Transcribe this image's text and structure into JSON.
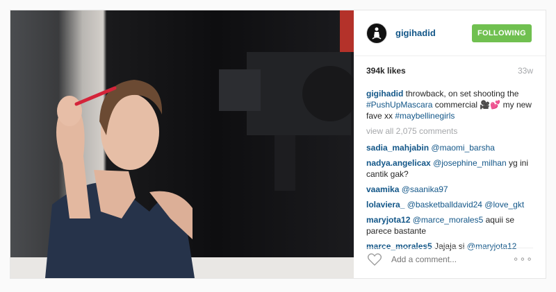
{
  "post": {
    "username": "gigihadid",
    "follow_label": "FOLLOWING",
    "likes": "394k likes",
    "age": "33w",
    "caption": {
      "user": "gigihadid",
      "text1": "throwback, on set shooting the",
      "tag1": "#PushUpMascara",
      "text2": "commercial 🎥💕 my new fave xx",
      "tag2": "#maybellinegirls"
    },
    "view_all": "view all 2,075 comments",
    "comments": [
      {
        "user": "sadia_mahjabin",
        "mention": "@maomi_barsha",
        "text": ""
      },
      {
        "user": "nadya.angelicax",
        "mention": "@josephine_milhan",
        "text": "yg ini cantik gak?"
      },
      {
        "user": "vaamika",
        "mention": "@saanika97",
        "text": ""
      },
      {
        "user": "lolaviera_",
        "mention": "@basketballdavid24 @love_gkt",
        "text": ""
      },
      {
        "user": "maryjota12",
        "mention": "@marce_morales5",
        "text": "aquii se parece bastante"
      },
      {
        "user": "marce_morales5",
        "mention": "@maryjota12",
        "text_before": "Jajaja si",
        "text": ""
      }
    ],
    "add_comment_placeholder": "Add a comment...",
    "more_label": "∘∘∘"
  },
  "icons": {
    "heart": "heart-icon",
    "more": "more-options-icon"
  },
  "colors": {
    "follow": "#70c050",
    "link": "#125688",
    "muted": "#a5a7aa"
  }
}
